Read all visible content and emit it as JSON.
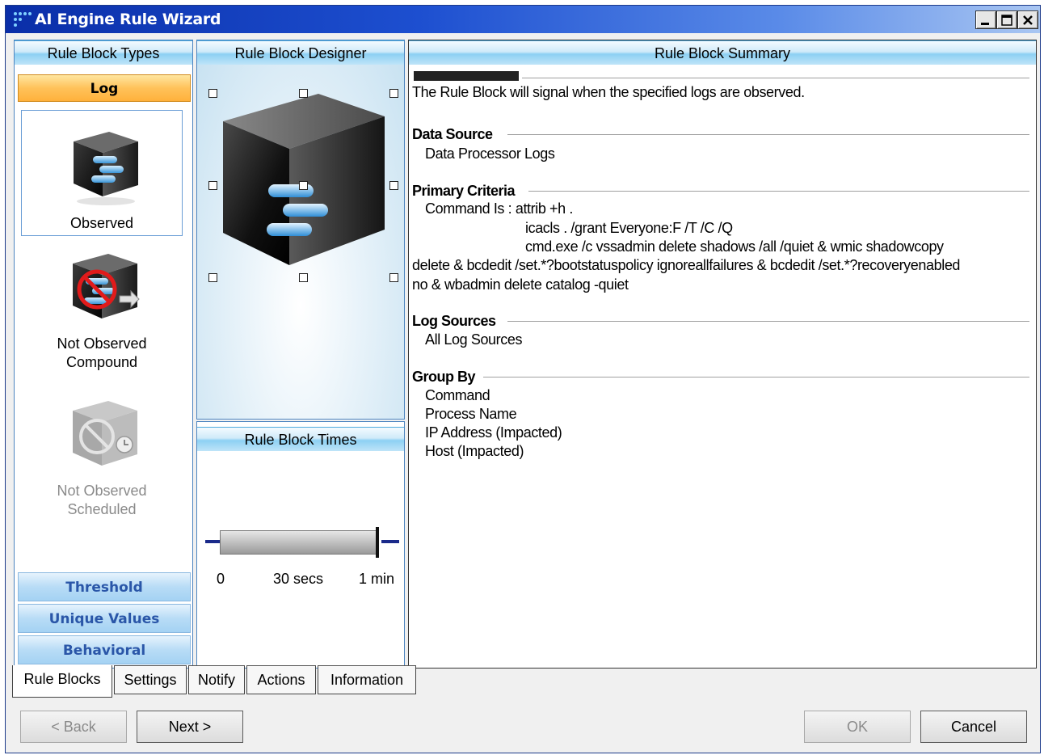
{
  "window": {
    "title": "AI Engine Rule Wizard"
  },
  "rule_block_types": {
    "header": "Rule Block Types",
    "active_category": "Log",
    "items": [
      {
        "label": "Observed",
        "icon": "observed-cube-icon",
        "selected": true,
        "enabled": true
      },
      {
        "label": "Not Observed\nCompound",
        "icon": "not-observed-compound-cube-icon",
        "selected": false,
        "enabled": true
      },
      {
        "label": "Not Observed\nScheduled",
        "icon": "not-observed-scheduled-cube-icon",
        "selected": false,
        "enabled": false
      }
    ],
    "categories": [
      "Threshold",
      "Unique Values",
      "Behavioral"
    ]
  },
  "designer": {
    "header": "Rule Block Designer"
  },
  "times": {
    "header": "Rule Block Times",
    "ticks": [
      "0",
      "30 secs",
      "1 min"
    ]
  },
  "summary": {
    "header": "Rule Block Summary",
    "intro": "The Rule Block will signal when the specified logs are observed.",
    "sections": [
      {
        "title": "Data Source",
        "lines": [
          "Data Processor Logs"
        ]
      },
      {
        "title": "Primary Criteria",
        "lines": [
          "Command Is : attrib +h .",
          "icacls . /grant Everyone:F /T /C /Q",
          "cmd.exe /c vssadmin delete shadows /all /quiet & wmic shadowcopy",
          "delete & bcdedit /set.*?bootstatuspolicy ignoreallfailures & bcdedit /set.*?recoveryenabled",
          "no & wbadmin delete catalog -quiet"
        ]
      },
      {
        "title": "Log Sources",
        "lines": [
          "All Log Sources"
        ]
      },
      {
        "title": "Group By",
        "lines": [
          "Command",
          "Process Name",
          "IP Address (Impacted)",
          "Host (Impacted)"
        ]
      }
    ]
  },
  "tabs": [
    "Rule Blocks",
    "Settings",
    "Notify",
    "Actions",
    "Information"
  ],
  "buttons": {
    "back": "< Back",
    "next": "Next >",
    "ok": "OK",
    "cancel": "Cancel"
  }
}
